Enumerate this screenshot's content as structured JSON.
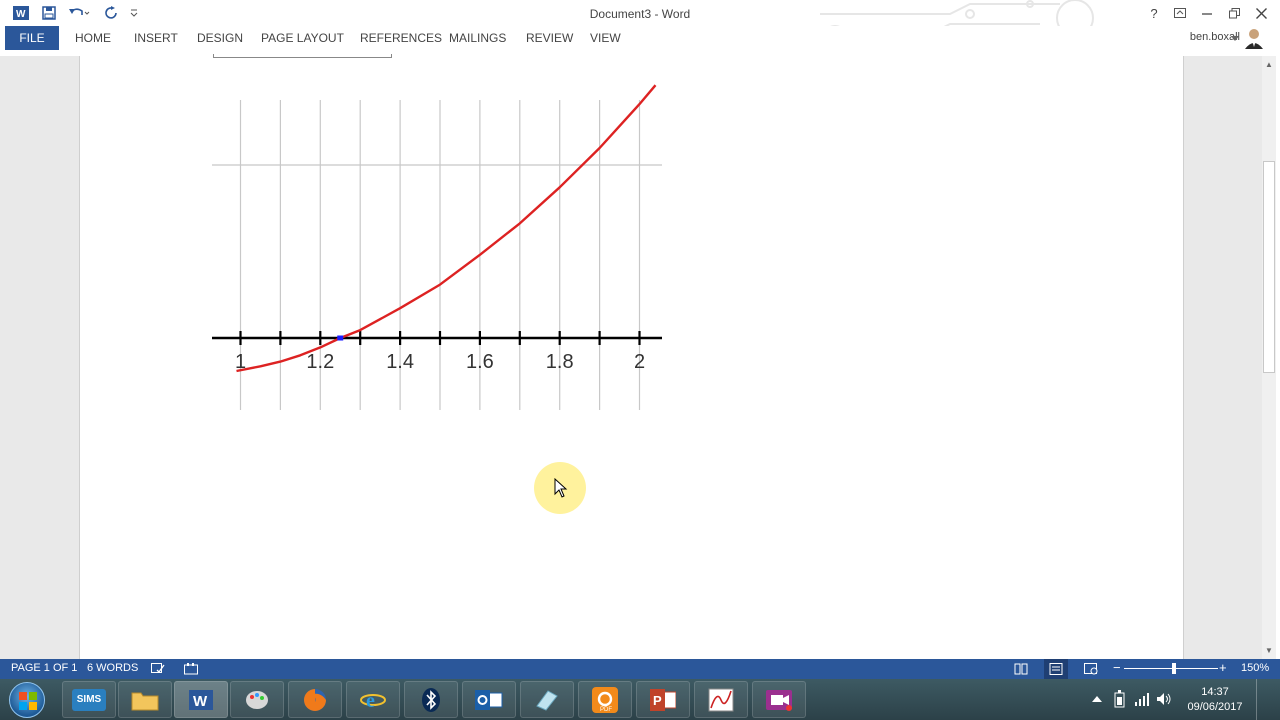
{
  "window": {
    "title": "Document3 - Word",
    "user_name": "ben.boxall"
  },
  "ribbon": {
    "tabs": [
      "FILE",
      "HOME",
      "INSERT",
      "DESIGN",
      "PAGE LAYOUT",
      "REFERENCES",
      "MAILINGS",
      "REVIEW",
      "VIEW"
    ]
  },
  "chart_data": {
    "type": "line",
    "title": "",
    "xlabel": "",
    "ylabel": "",
    "x_ticks": [
      "1",
      "1.2",
      "1.4",
      "1.6",
      "1.8",
      "2"
    ],
    "xlim": [
      0.99,
      2.06
    ],
    "grid": true,
    "series": [
      {
        "color": "#dd2222",
        "x": [
          0.99,
          1.05,
          1.1,
          1.15,
          1.2,
          1.25,
          1.3,
          1.4,
          1.5,
          1.6,
          1.7,
          1.8,
          1.9,
          2.0,
          2.04
        ],
        "y": [
          -0.21,
          -0.18,
          -0.15,
          -0.11,
          -0.06,
          0.0,
          0.05,
          0.19,
          0.34,
          0.53,
          0.73,
          0.96,
          1.21,
          1.49,
          1.61
        ]
      }
    ],
    "marker": {
      "x": 1.25,
      "y": 0,
      "color": "#1a1aff"
    }
  },
  "status": {
    "page": "PAGE 1 OF 1",
    "words": "6 WORDS",
    "zoom": "150%"
  },
  "taskbar": {
    "sims_label": "SIMS",
    "time": "14:37",
    "date": "09/06/2017"
  }
}
